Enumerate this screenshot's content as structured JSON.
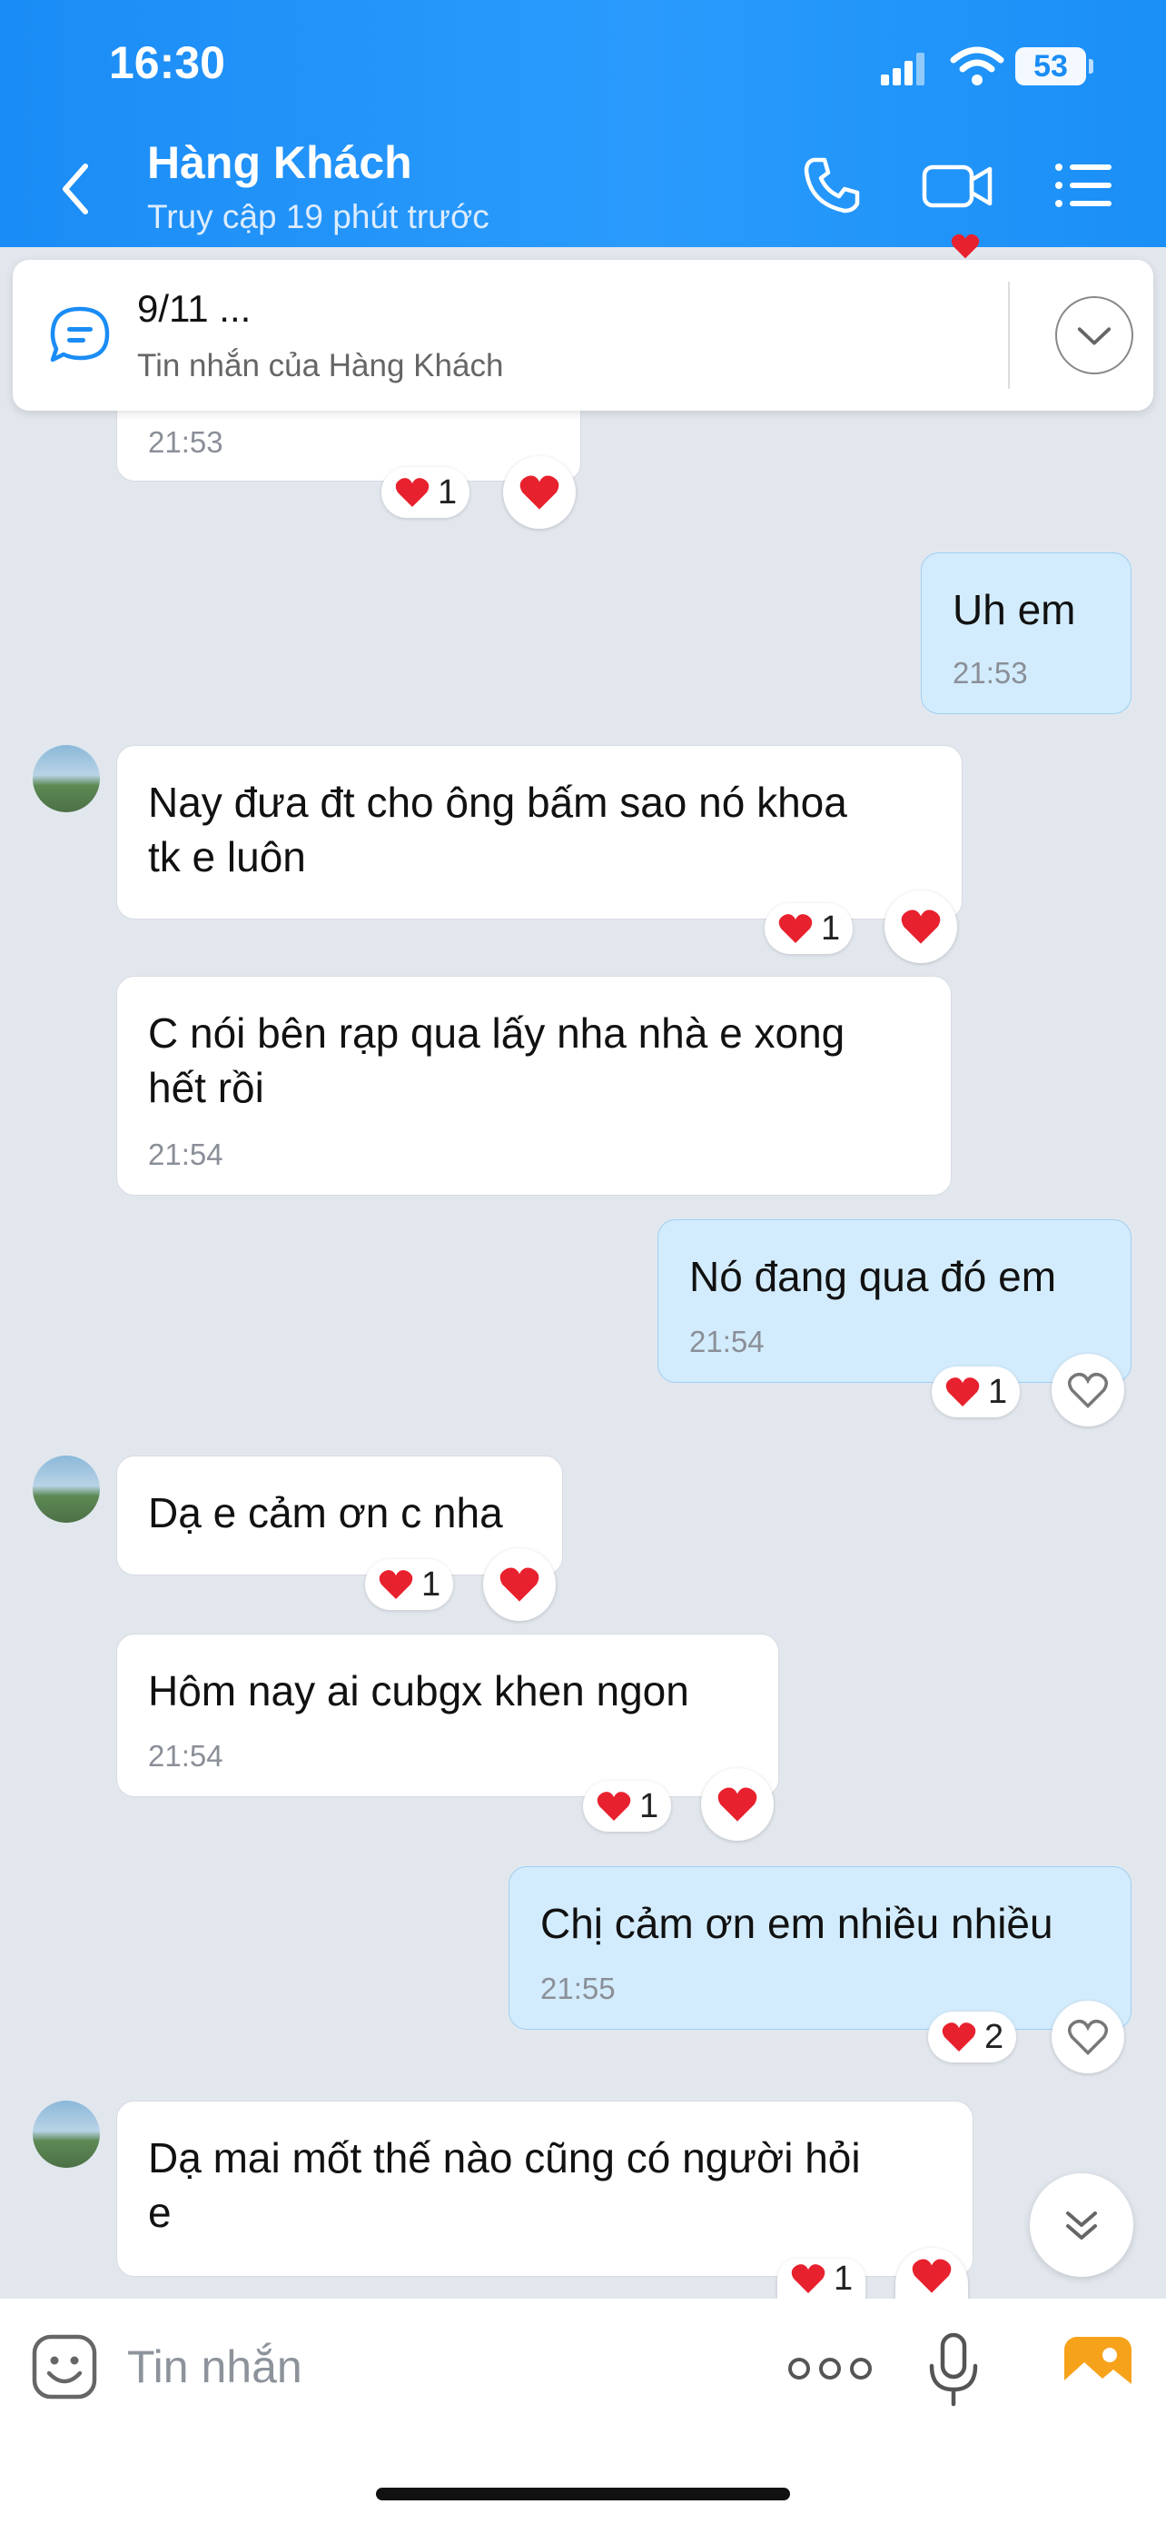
{
  "status_bar": {
    "time": "16:30",
    "battery": "53"
  },
  "header": {
    "title": "Hàng Khách",
    "subtitle": "Truy cập 19 phút trước"
  },
  "pinned": {
    "title": "9/11 ...",
    "subtitle": "Tin nhắn của Hàng Khách"
  },
  "messages": [
    {
      "time": "21:53",
      "reaction_count": "1"
    },
    {
      "text": "Uh em",
      "time": "21:53"
    },
    {
      "text": "Nay đưa đt cho ông bấm sao nó khoa tk e luôn",
      "line1": "Nay đưa đt cho ông bấm sao nó khoa",
      "line2": "tk e luôn",
      "reaction_count": "1"
    },
    {
      "text": "C nói bên rạp qua lấy nha nhà e xong hết rồi",
      "line1": "C nói bên rạp qua lấy nha nhà e xong",
      "line2": "hết rồi",
      "time": "21:54"
    },
    {
      "text": "Nó đang qua đó em",
      "time": "21:54",
      "reaction_count": "1"
    },
    {
      "text": "Dạ e cảm ơn c nha",
      "reaction_count": "1"
    },
    {
      "text": "Hôm nay ai cubgx khen ngon",
      "time": "21:54",
      "reaction_count": "1"
    },
    {
      "text": "Chị cảm ơn em nhiều nhiều",
      "time": "21:55",
      "reaction_count": "2"
    },
    {
      "text": "Dạ mai mốt thế nào cũng có người hỏi e",
      "line1": "Dạ mai mốt thế nào cũng có người hỏi",
      "line2": "e",
      "reaction_count": "1"
    }
  ],
  "input": {
    "placeholder": "Tin nhắn"
  },
  "icons": {
    "back": "chevron-left-icon",
    "call": "phone-icon",
    "video": "video-camera-icon",
    "menu": "list-menu-icon",
    "pinned": "chat-bubble-icon",
    "expand": "chevron-down-icon",
    "heart": "heart-icon",
    "sticker": "sticker-icon",
    "more": "more-dots-icon",
    "mic": "microphone-icon",
    "gallery": "gallery-icon"
  },
  "colors": {
    "header": "#1a8cf5",
    "outgoing_bubble": "#d3ecfd",
    "incoming_bubble": "#ffffff",
    "heart": "#e8212e",
    "background": "#e2e7ee"
  }
}
